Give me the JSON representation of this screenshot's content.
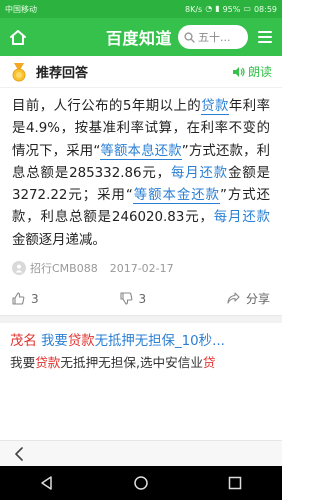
{
  "status_bar": {
    "carrier": "中国移动",
    "speed": "8K/s",
    "battery": "95%",
    "time": "08:59"
  },
  "nav": {
    "title": "百度知道",
    "search_placeholder": "五十..."
  },
  "card": {
    "title": "推荐回答",
    "read_aloud": "朗读"
  },
  "answer": {
    "segments": [
      "目前，人行公布的5年期以上的",
      "贷款",
      "年利率是4.9%，按基准利率试算，在利率不变的情况下，采用“",
      "等额本息还款",
      "”方式还款，利息总额是285332.86元，",
      "每月还款",
      "金额是3272.22元；采用“",
      "等额本金还款",
      "”方式还款，利息总额是246020.83元，",
      "每月还款",
      "金额逐月递减。"
    ]
  },
  "meta": {
    "author": "招行CMB088",
    "date": "2017-02-17"
  },
  "actions": {
    "like_count": "3",
    "dislike_count": "3",
    "share_label": "分享"
  },
  "ad": {
    "prefix": "茂名",
    "title_a": "我要",
    "title_kw": "贷款",
    "title_b": "无抵押无担保_10秒...",
    "desc_a": "我要",
    "desc_kw": "贷款",
    "desc_b": "无抵押无担保,选中安信业",
    "desc_kw2": "贷"
  },
  "colors": {
    "brand_green": "#35c14b",
    "status_green": "#2cb23e",
    "link_blue": "#2a7fd4",
    "ad_red": "#e0322d"
  },
  "icons": [
    "home-icon",
    "search-icon",
    "menu-icon",
    "medal-icon",
    "speaker-icon",
    "user-icon",
    "thumbs-up-icon",
    "thumbs-down-icon",
    "share-icon",
    "back-arrow-icon",
    "android-back-icon",
    "android-home-icon",
    "android-recents-icon"
  ]
}
